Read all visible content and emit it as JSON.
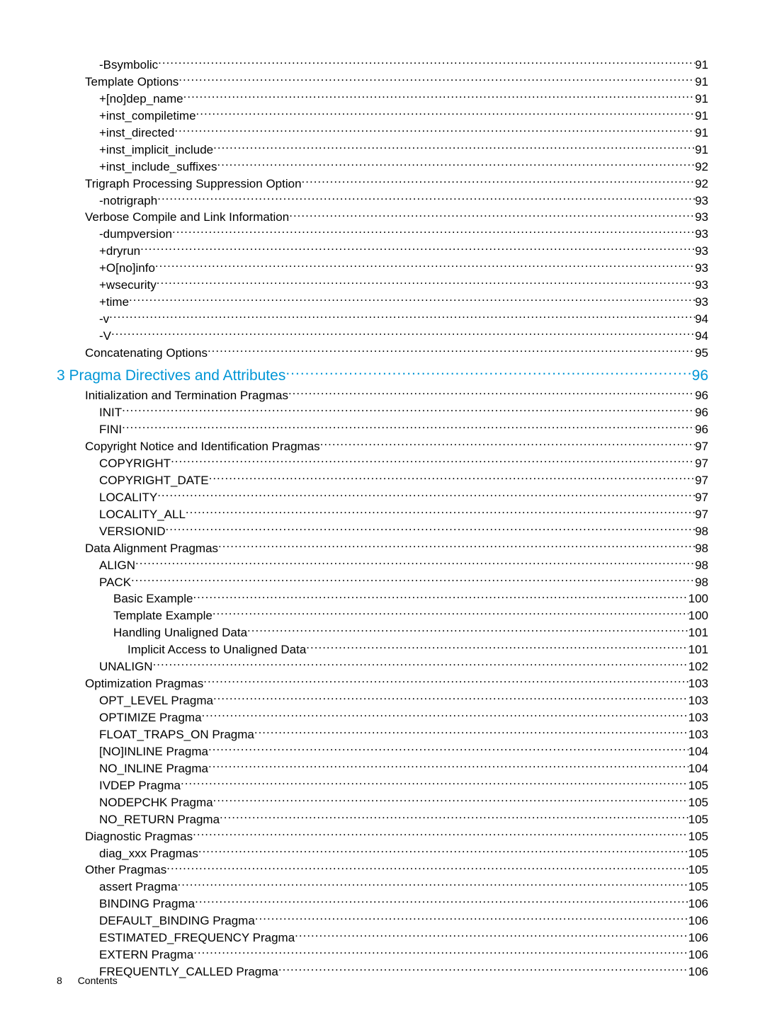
{
  "footer": {
    "page_number": "8",
    "label": "Contents"
  },
  "chapter_accent": "#0096d6",
  "entries": [
    {
      "label": "-Bsymbolic",
      "page": "91",
      "level": 3
    },
    {
      "label": "Template Options",
      "page": "91",
      "level": 2
    },
    {
      "label": "+[no]dep_name",
      "page": "91",
      "level": 3
    },
    {
      "label": "+inst_compiletime",
      "page": "91",
      "level": 3
    },
    {
      "label": "+inst_directed",
      "page": "91",
      "level": 3
    },
    {
      "label": "+inst_implicit_include",
      "page": "91",
      "level": 3
    },
    {
      "label": "+inst_include_suffixes",
      "page": "92",
      "level": 3
    },
    {
      "label": "Trigraph Processing Suppression Option",
      "page": "92",
      "level": 2
    },
    {
      "label": "-notrigraph",
      "page": "93",
      "level": 3
    },
    {
      "label": "Verbose Compile and Link Information",
      "page": "93",
      "level": 2
    },
    {
      "label": "-dumpversion",
      "page": "93",
      "level": 3
    },
    {
      "label": "+dryrun",
      "page": "93",
      "level": 3
    },
    {
      "label": "+O[no]info",
      "page": "93",
      "level": 3
    },
    {
      "label": "+wsecurity",
      "page": "93",
      "level": 3
    },
    {
      "label": "+time",
      "page": "93",
      "level": 3
    },
    {
      "label": "-v",
      "page": "94",
      "level": 3
    },
    {
      "label": "-V",
      "page": "94",
      "level": 3
    },
    {
      "label": "Concatenating Options",
      "page": "95",
      "level": 2
    },
    {
      "label": "3 Pragma Directives and Attributes",
      "page": "96",
      "level": 0,
      "chapter": true
    },
    {
      "label": "Initialization and Termination Pragmas",
      "page": "96",
      "level": 2
    },
    {
      "label": "INIT",
      "page": "96",
      "level": 3
    },
    {
      "label": "FINI",
      "page": "96",
      "level": 3
    },
    {
      "label": "Copyright Notice and Identification Pragmas",
      "page": "97",
      "level": 2
    },
    {
      "label": "COPYRIGHT",
      "page": "97",
      "level": 3
    },
    {
      "label": "COPYRIGHT_DATE",
      "page": "97",
      "level": 3
    },
    {
      "label": "LOCALITY",
      "page": "97",
      "level": 3
    },
    {
      "label": "LOCALITY_ALL",
      "page": "97",
      "level": 3
    },
    {
      "label": "VERSIONID",
      "page": "98",
      "level": 3
    },
    {
      "label": "Data Alignment Pragmas",
      "page": "98",
      "level": 2
    },
    {
      "label": "ALIGN",
      "page": "98",
      "level": 3
    },
    {
      "label": "PACK ",
      "page": "98",
      "level": 3
    },
    {
      "label": "Basic Example",
      "page": "100",
      "level": 4
    },
    {
      "label": "Template Example",
      "page": "100",
      "level": 4
    },
    {
      "label": "Handling Unaligned Data",
      "page": "101",
      "level": 4
    },
    {
      "label": "Implicit Access to Unaligned Data",
      "page": "101",
      "level": 5
    },
    {
      "label": "UNALIGN",
      "page": "102",
      "level": 3
    },
    {
      "label": "Optimization Pragmas",
      "page": "103",
      "level": 2
    },
    {
      "label": "OPT_LEVEL Pragma",
      "page": "103",
      "level": 3
    },
    {
      "label": "OPTIMIZE Pragma",
      "page": "103",
      "level": 3
    },
    {
      "label": "FLOAT_TRAPS_ON Pragma",
      "page": "103",
      "level": 3
    },
    {
      "label": "[NO]INLINE Pragma",
      "page": "104",
      "level": 3
    },
    {
      "label": "NO_INLINE Pragma",
      "page": "104",
      "level": 3
    },
    {
      "label": "IVDEP Pragma",
      "page": "105",
      "level": 3
    },
    {
      "label": "NODEPCHK Pragma",
      "page": "105",
      "level": 3
    },
    {
      "label": "NO_RETURN Pragma",
      "page": "105",
      "level": 3
    },
    {
      "label": "Diagnostic Pragmas",
      "page": "105",
      "level": 2
    },
    {
      "label": "diag_xxx Pragmas",
      "page": "105",
      "level": 3
    },
    {
      "label": "Other Pragmas",
      "page": "105",
      "level": 2
    },
    {
      "label": "assert Pragma",
      "page": "105",
      "level": 3
    },
    {
      "label": "BINDING Pragma",
      "page": "106",
      "level": 3
    },
    {
      "label": "DEFAULT_BINDING Pragma",
      "page": "106",
      "level": 3
    },
    {
      "label": "ESTIMATED_FREQUENCY Pragma",
      "page": "106",
      "level": 3
    },
    {
      "label": "EXTERN Pragma",
      "page": "106",
      "level": 3
    },
    {
      "label": "FREQUENTLY_CALLED Pragma",
      "page": "106",
      "level": 3
    }
  ]
}
